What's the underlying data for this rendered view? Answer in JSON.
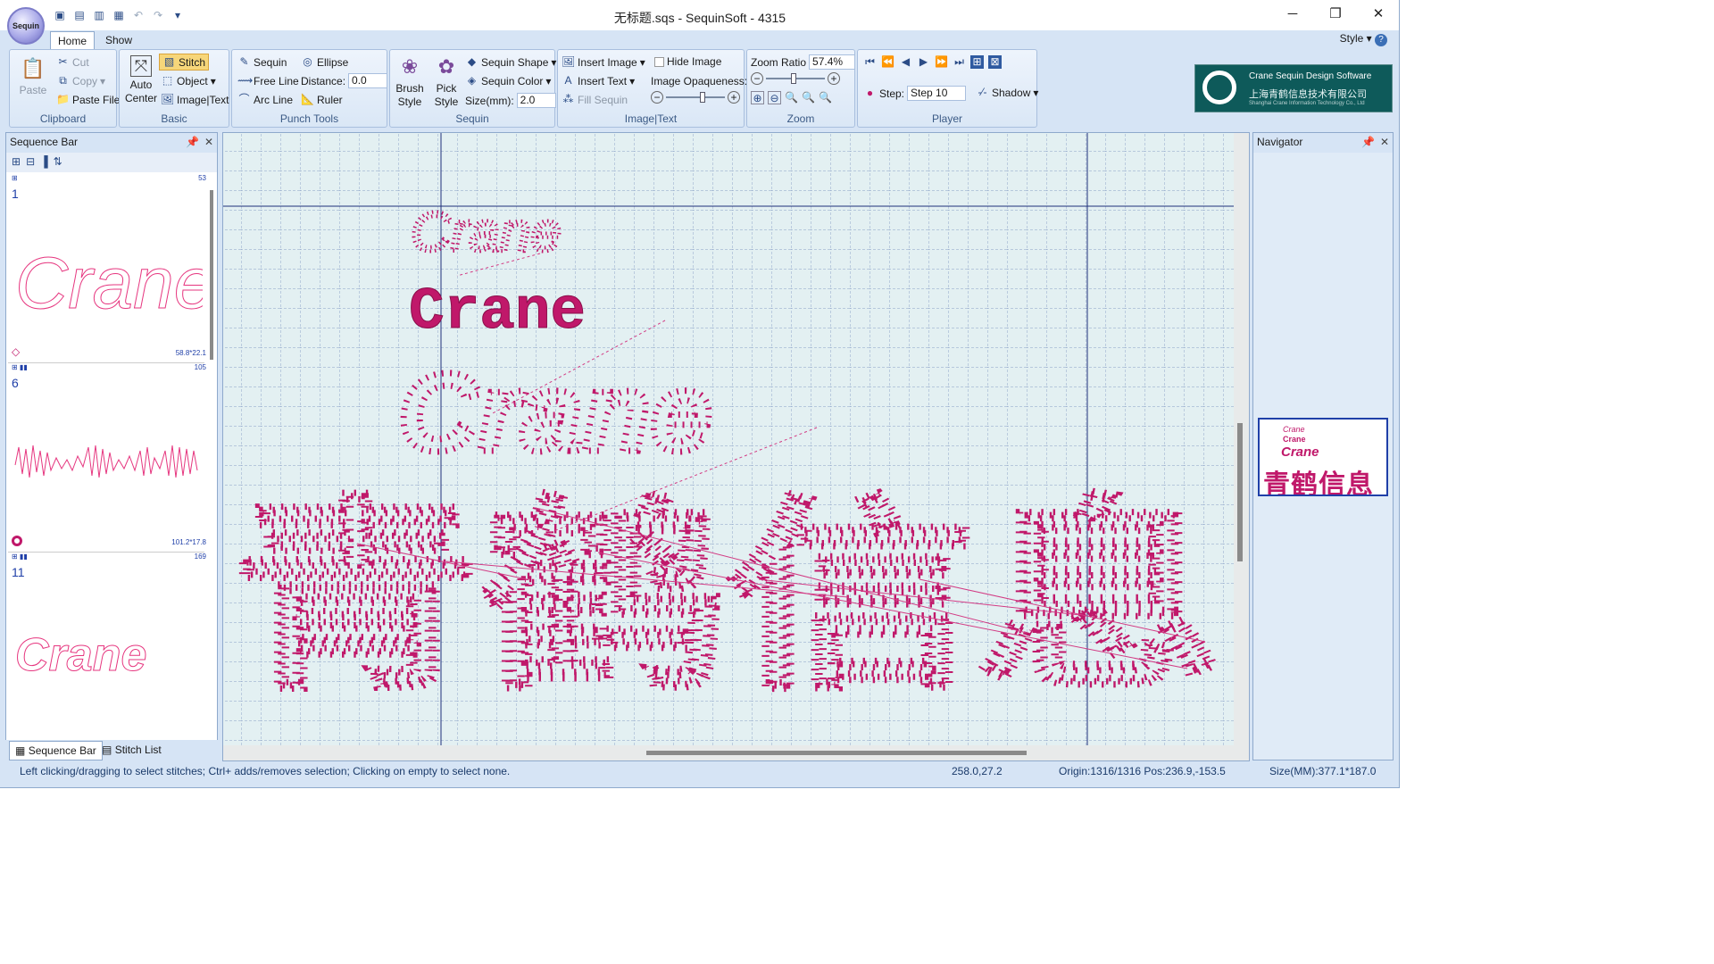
{
  "window": {
    "title": "无标题.sqs - SequinSoft - 4315",
    "orb_label": "Sequin"
  },
  "tabs": [
    {
      "label": "Home",
      "active": true
    },
    {
      "label": "Show",
      "active": false
    }
  ],
  "style_menu": "Style",
  "ribbon": {
    "clipboard": {
      "label": "Clipboard",
      "paste": "Paste",
      "cut": "Cut",
      "copy": "Copy",
      "paste_file": "Paste File"
    },
    "basic": {
      "label": "Basic",
      "auto_center": "Auto Center",
      "stitch": "Stitch",
      "object": "Object",
      "image_text": "Image|Text"
    },
    "punch_tools": {
      "label": "Punch Tools",
      "sequin": "Sequin",
      "ellipse": "Ellipse",
      "free_line": "Free Line",
      "distance_label": "Distance:",
      "distance_value": "0.0",
      "arc_line": "Arc Line",
      "ruler": "Ruler"
    },
    "sequin": {
      "label": "Sequin",
      "brush_style": "Brush Style",
      "pick_style": "Pick Style",
      "sequin_shape": "Sequin Shape",
      "sequin_color": "Sequin Color",
      "size_label": "Size(mm):",
      "size_value": "2.0"
    },
    "image_text": {
      "label": "Image|Text",
      "insert_image": "Insert Image",
      "insert_text": "Insert Text",
      "fill_sequin": "Fill Sequin",
      "hide_image": "Hide Image",
      "image_opaqueness": "Image Opaqueness:"
    },
    "zoom": {
      "label": "Zoom",
      "zoom_ratio_label": "Zoom Ratio",
      "zoom_ratio_value": "57.4%"
    },
    "player": {
      "label": "Player",
      "step_label": "Step:",
      "step_value": "Step 10",
      "shadow": "Shadow"
    },
    "logo": {
      "line1": "Crane Sequin Design Software",
      "line2": "上海青鹤信息技术有限公司",
      "line3": "Shanghai Crane Information Technology Co., Ltd"
    }
  },
  "sequence_bar": {
    "title": "Sequence Bar",
    "items": [
      {
        "number": "1",
        "count": "53",
        "size": "58.8*22.1"
      },
      {
        "number": "6",
        "count": "105",
        "size": "101.2*17.8"
      },
      {
        "number": "11",
        "count": "169",
        "size": ""
      }
    ]
  },
  "bottom_tabs": [
    {
      "label": "Sequence Bar"
    },
    {
      "label": "Stitch List"
    }
  ],
  "canvas": {
    "design_texts": [
      "Crane",
      "Crane",
      "Crane",
      "青鹤信息"
    ]
  },
  "navigator": {
    "title": "Navigator",
    "preview_texts": [
      "Crane",
      "Crane",
      "Crane",
      "青鹤信息"
    ]
  },
  "status": {
    "hint": "Left clicking/dragging to select stitches; Ctrl+ adds/removes selection; Clicking on empty to select none.",
    "coords": "258.0,27.2",
    "origin": "Origin:1316/1316 Pos:236.9,-153.5",
    "size": "Size(MM):377.1*187.0"
  },
  "colors": {
    "stitch": "#c0186a",
    "grid_bg": "#e3f0f2",
    "ribbon_bg": "#d6e4f5"
  }
}
